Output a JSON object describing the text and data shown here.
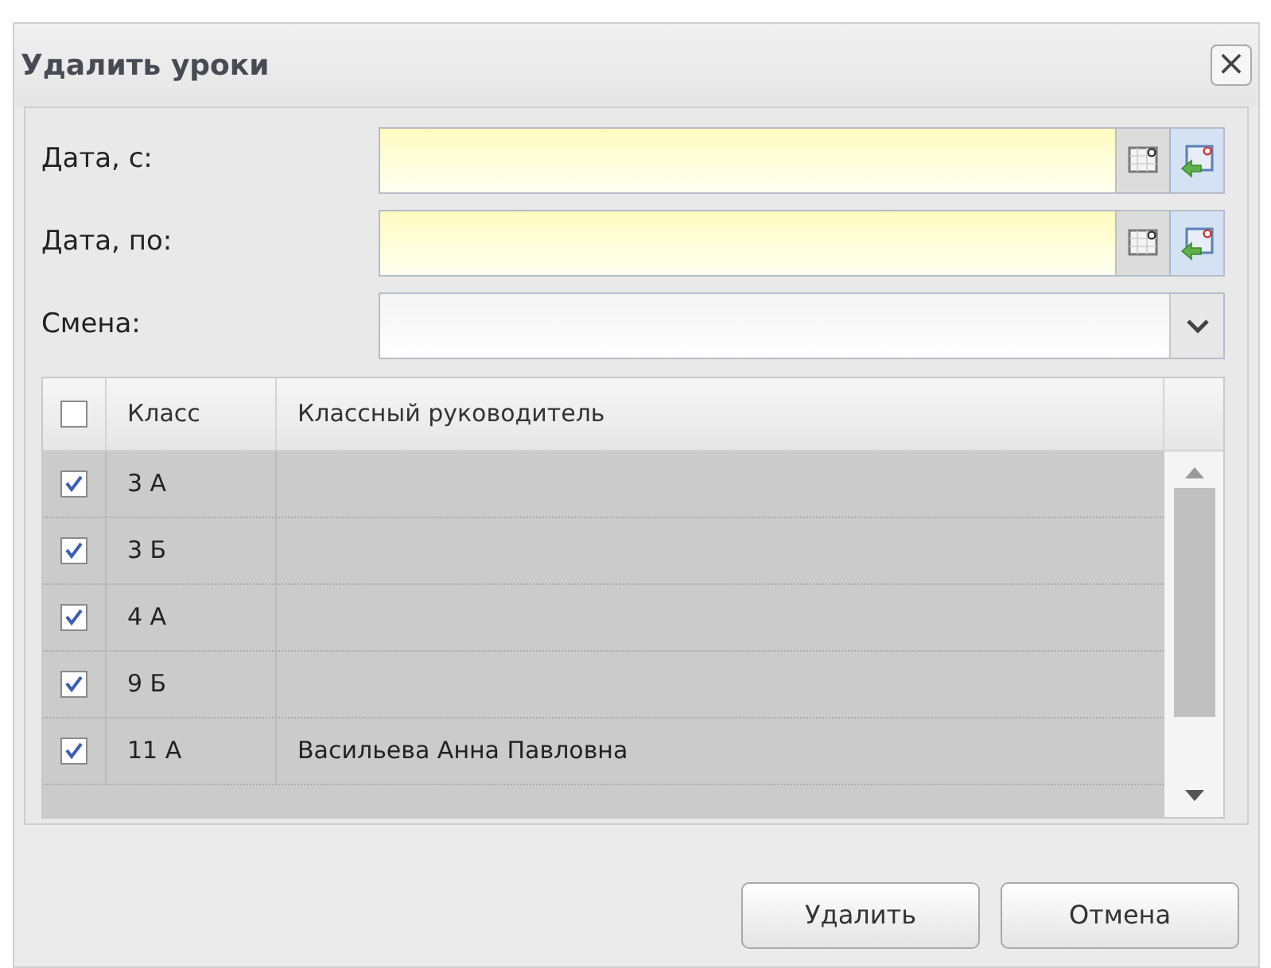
{
  "window": {
    "title": "Удалить уроки",
    "close_label": "×"
  },
  "fields": [
    {
      "label": "Дата, с:",
      "kind": "date",
      "required": true
    },
    {
      "label": "Дата, по:",
      "kind": "date",
      "required": true
    },
    {
      "label": "Смена:",
      "kind": "combo",
      "required": false
    }
  ],
  "table": {
    "header_checked": false,
    "columns": [
      "Класс",
      "Классный руководитель"
    ],
    "rows": [
      {
        "checked": true,
        "cells": [
          "3 А",
          ""
        ]
      },
      {
        "checked": true,
        "cells": [
          "3 Б",
          ""
        ]
      },
      {
        "checked": true,
        "cells": [
          "4 А",
          ""
        ]
      },
      {
        "checked": true,
        "cells": [
          "9 Б",
          ""
        ]
      },
      {
        "checked": true,
        "cells": [
          "11 А",
          "Васильева Анна Павловна"
        ]
      }
    ]
  },
  "buttons": [
    "Удалить",
    "Отмена"
  ]
}
